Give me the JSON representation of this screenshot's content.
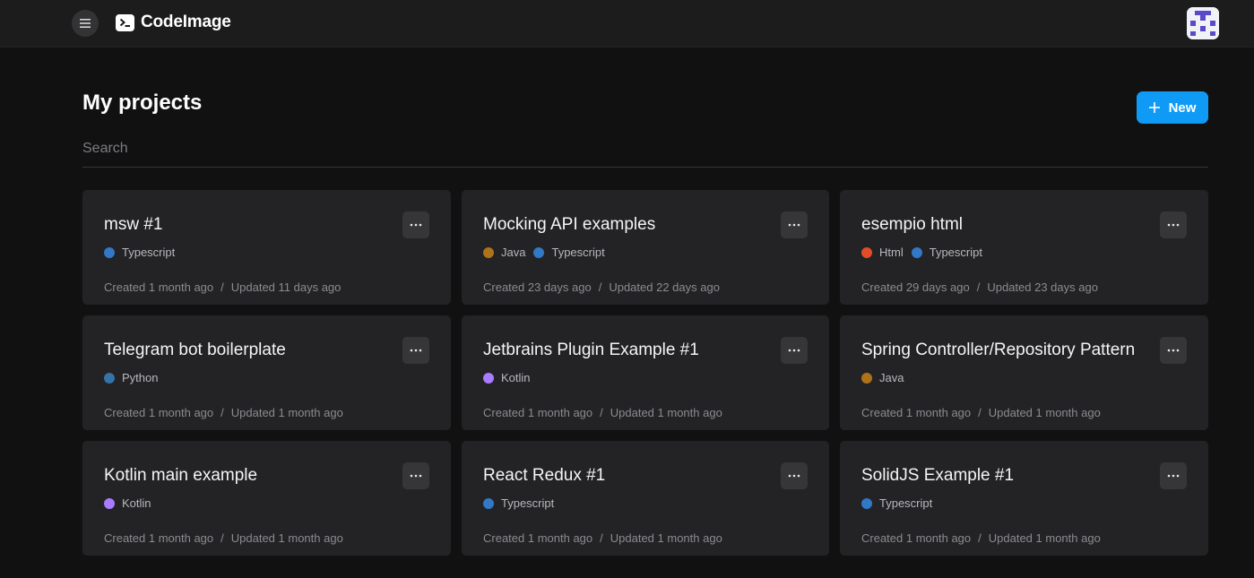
{
  "app": {
    "name": "CodeImage"
  },
  "header": {
    "menu_icon": "hamburger-icon",
    "logo_icon": "terminal-prompt-icon",
    "avatar_icon": "pixel-avatar-icon"
  },
  "page": {
    "title": "My projects",
    "new_button_label": "New",
    "new_button_icon": "plus-icon",
    "search_placeholder": "Search"
  },
  "colors": {
    "accent": "#0f9bf5",
    "Typescript": "#3178c6",
    "Java": "#b07219",
    "Html": "#e34c26",
    "Python": "#3572a5",
    "Kotlin": "#a97bff"
  },
  "projects": [
    {
      "title": "msw #1",
      "languages": [
        "Typescript"
      ],
      "created": "Created 1 month ago",
      "updated": "Updated 11 days ago"
    },
    {
      "title": "Mocking API examples",
      "languages": [
        "Java",
        "Typescript"
      ],
      "created": "Created 23 days ago",
      "updated": "Updated 22 days ago"
    },
    {
      "title": "esempio html",
      "languages": [
        "Html",
        "Typescript"
      ],
      "created": "Created 29 days ago",
      "updated": "Updated 23 days ago"
    },
    {
      "title": "Telegram bot boilerplate",
      "languages": [
        "Python"
      ],
      "created": "Created 1 month ago",
      "updated": "Updated 1 month ago"
    },
    {
      "title": "Jetbrains Plugin Example #1",
      "languages": [
        "Kotlin"
      ],
      "created": "Created 1 month ago",
      "updated": "Updated 1 month ago"
    },
    {
      "title": "Spring Controller/Repository Pattern",
      "languages": [
        "Java"
      ],
      "created": "Created 1 month ago",
      "updated": "Updated 1 month ago"
    },
    {
      "title": "Kotlin main example",
      "languages": [
        "Kotlin"
      ],
      "created": "Created 1 month ago",
      "updated": "Updated 1 month ago"
    },
    {
      "title": "React Redux #1",
      "languages": [
        "Typescript"
      ],
      "created": "Created 1 month ago",
      "updated": "Updated 1 month ago"
    },
    {
      "title": "SolidJS Example #1",
      "languages": [
        "Typescript"
      ],
      "created": "Created 1 month ago",
      "updated": "Updated 1 month ago"
    }
  ],
  "date_separator": "/"
}
